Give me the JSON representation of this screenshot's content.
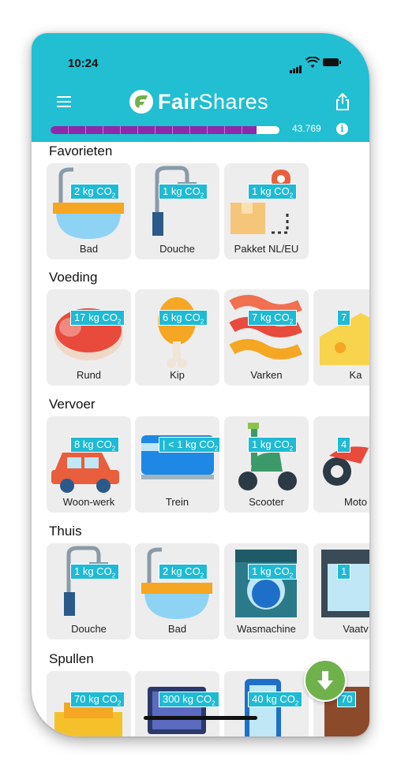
{
  "status_bar": {
    "time": "10:24"
  },
  "header": {
    "brand_bold": "Fair",
    "brand_regular": "Shares",
    "score": "43.769",
    "info": "i"
  },
  "progress": {
    "fraction": 0.9
  },
  "colors": {
    "header": "#22bed2",
    "progress": "#8e2aaa",
    "badge": "#1fbad4",
    "fab": "#6fb24c"
  },
  "sections": [
    {
      "title": "Favorieten",
      "items": [
        {
          "label": "Bad",
          "badge": "2 kg CO",
          "icon": "bath-icon"
        },
        {
          "label": "Douche",
          "badge": "1 kg CO",
          "icon": "shower-icon"
        },
        {
          "label": "Pakket NL/EU",
          "badge": "1 kg CO",
          "icon": "package-icon"
        }
      ]
    },
    {
      "title": "Voeding",
      "items": [
        {
          "label": "Rund",
          "badge": "17 kg CO",
          "icon": "steak-icon"
        },
        {
          "label": "Kip",
          "badge": "6 kg CO",
          "icon": "chicken-icon"
        },
        {
          "label": "Varken",
          "badge": "7 kg CO",
          "icon": "bacon-icon"
        },
        {
          "label": "Ka",
          "badge": "7",
          "icon": "cheese-icon"
        }
      ]
    },
    {
      "title": "Vervoer",
      "items": [
        {
          "label": "Woon-werk",
          "badge": "8 kg CO",
          "icon": "car-icon"
        },
        {
          "label": "Trein",
          "badge": "| < 1 kg CO",
          "icon": "train-icon"
        },
        {
          "label": "Scooter",
          "badge": "1 kg CO",
          "icon": "scooter-icon"
        },
        {
          "label": "Moto",
          "badge": "4",
          "icon": "motorcycle-icon"
        }
      ]
    },
    {
      "title": "Thuis",
      "items": [
        {
          "label": "Douche",
          "badge": "1 kg CO",
          "icon": "shower-icon"
        },
        {
          "label": "Bad",
          "badge": "2 kg CO",
          "icon": "bath-icon"
        },
        {
          "label": "Wasmachine",
          "badge": "1 kg CO",
          "icon": "washing-machine-icon"
        },
        {
          "label": "Vaatv",
          "badge": "1",
          "icon": "dishwasher-icon"
        }
      ]
    },
    {
      "title": "Spullen",
      "items": [
        {
          "label": "",
          "badge": "70 kg CO",
          "icon": "clothes-icon"
        },
        {
          "label": "",
          "badge": "300 kg CO",
          "icon": "laptop-icon"
        },
        {
          "label": "",
          "badge": "40 kg CO",
          "icon": "phone-icon"
        },
        {
          "label": "",
          "badge": "70",
          "icon": "furniture-icon"
        }
      ]
    }
  ]
}
